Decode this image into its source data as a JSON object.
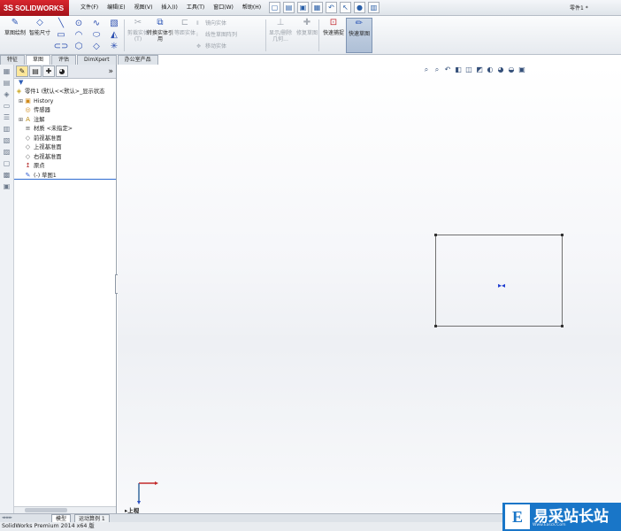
{
  "app": {
    "logo_text": "SOLIDWORKS",
    "document_title": "零件1 *"
  },
  "menus": [
    "文件(F)",
    "编辑(E)",
    "视图(V)",
    "插入(I)",
    "工具(T)",
    "窗口(W)",
    "帮助(H)"
  ],
  "command_manager": {
    "sketch_label": "草图绘制",
    "smart_dim_label": "智能尺寸",
    "trim_label": "剪裁实体(T)",
    "convert_label": "转换实体引用",
    "offset_label": "等距实体",
    "mirror_label": "镜向实体",
    "linear_pattern_label": "线性草图阵列",
    "move_label": "移动实体",
    "display_delete_label": "显示/删除几何...",
    "repair_label": "修复草图",
    "quick_snap_label": "快速捕捉",
    "rapid_sketch_label": "快速草图"
  },
  "tabs": [
    "特征",
    "草图",
    "评估",
    "DimXpert",
    "办公室产品"
  ],
  "active_tab": "草图",
  "feature_tree": {
    "root": "零件1 (默认<<默认>_显示状态",
    "items": [
      {
        "label": "History",
        "icon": "history-icon",
        "expandable": true
      },
      {
        "label": "传感器",
        "icon": "sensor-icon",
        "expandable": false
      },
      {
        "label": "注解",
        "icon": "annotation-icon",
        "expandable": true
      },
      {
        "label": "材质 <未指定>",
        "icon": "material-icon",
        "expandable": false
      },
      {
        "label": "前视基准面",
        "icon": "plane-icon",
        "expandable": false
      },
      {
        "label": "上视基准面",
        "icon": "plane-icon",
        "expandable": false
      },
      {
        "label": "右视基准面",
        "icon": "plane-icon",
        "expandable": false
      },
      {
        "label": "原点",
        "icon": "origin-icon",
        "expandable": false
      },
      {
        "label": "(-) 草图1",
        "icon": "sketch-icon",
        "expandable": false
      }
    ]
  },
  "graphics": {
    "view_label": "上视"
  },
  "bottom_tabs": [
    "模型",
    "运动算例 1"
  ],
  "status_bar": "SolidWorks Premium 2014 x64 版",
  "watermark": {
    "logo_glyph": "E",
    "text": "易采站长站",
    "url": "Www.Easck.Com"
  },
  "colors": {
    "accent": "#d8262e",
    "selection": "#2e6bd0",
    "watermark_bg": "#1976c8"
  }
}
